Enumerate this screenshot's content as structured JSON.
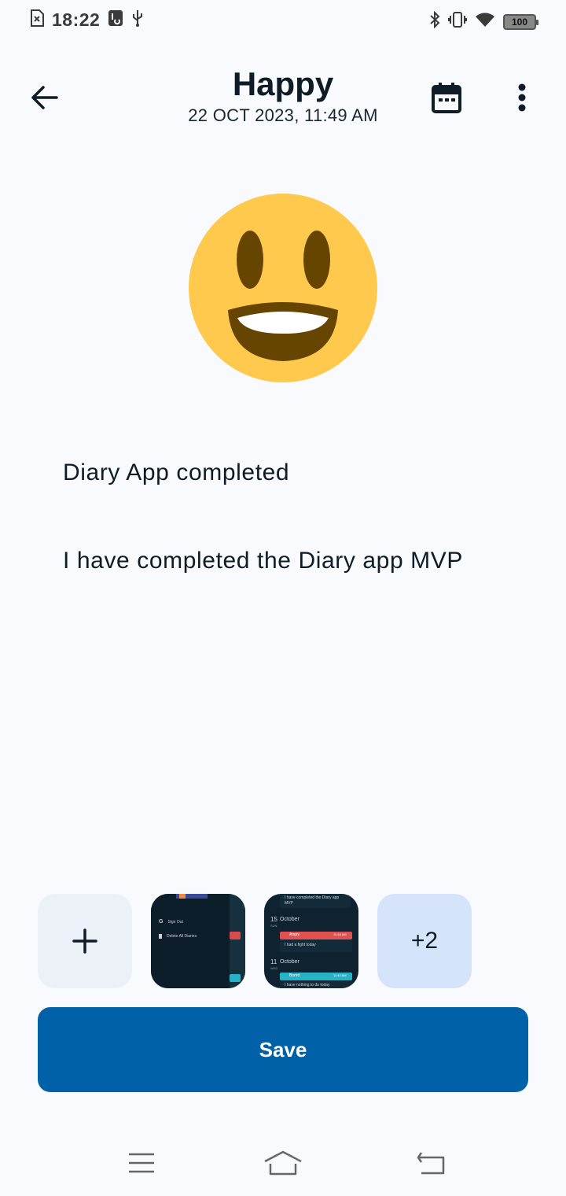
{
  "status_bar": {
    "time": "18:22",
    "battery": "100",
    "icons": [
      "sim-off-icon",
      "usb-debug-icon",
      "usb-icon",
      "bluetooth-icon",
      "vibrate-icon",
      "wifi-icon",
      "battery-icon"
    ]
  },
  "app_bar": {
    "title": "Happy",
    "subtitle": "22 OCT 2023, 11:49 AM",
    "icons": [
      "back-arrow-icon",
      "calendar-icon",
      "more-vert-icon"
    ]
  },
  "mood": {
    "icon": "happy-emoji-icon",
    "colors": {
      "face": "#ffc94d",
      "features": "#664500",
      "teeth": "#ffffff"
    }
  },
  "entry": {
    "title": "Diary App completed",
    "body": "I have completed the Diary app MVP"
  },
  "gallery": {
    "add_icon": "plus-icon",
    "more_label": "+2",
    "thumb1": {
      "items": [
        "Sign Out",
        "Delete All Diaries"
      ]
    },
    "thumb2": {
      "lines": [
        "I have completed the Diary app",
        "MVP"
      ],
      "day1": "15",
      "day1_month": "October",
      "day1_week": "SUN",
      "mood1": "Angry",
      "time1": "11:48 AM",
      "text1": "I had a fight today",
      "day2": "11",
      "day2_month": "October",
      "day2_week": "WED",
      "mood2": "Bored",
      "time2": "11:43 AM",
      "text2": "I have nothing to do today"
    }
  },
  "save_button": {
    "label": "Save",
    "color": "#0061a8"
  },
  "nav_bar": {
    "icons": [
      "menu-icon",
      "home-icon",
      "back-icon"
    ]
  }
}
